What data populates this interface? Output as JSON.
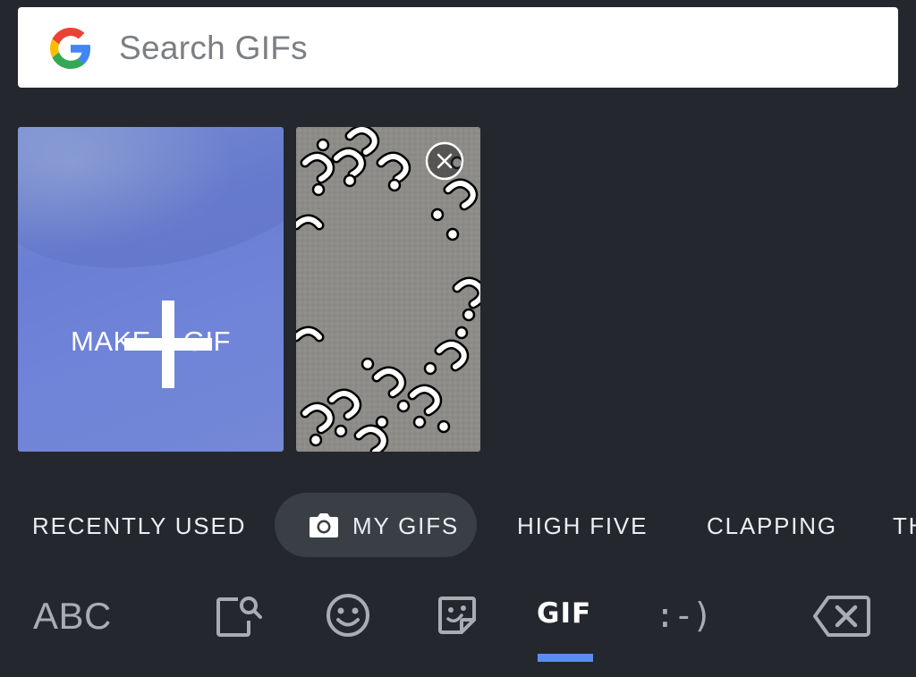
{
  "search": {
    "placeholder": "Search GIFs",
    "icon": "google-g-icon"
  },
  "tiles": {
    "make_gif": {
      "label": "MAKE A GIF",
      "icon": "plus-icon"
    },
    "saved_gif": {
      "remove_icon": "close-icon"
    }
  },
  "categories": [
    {
      "label": "RECENTLY USED",
      "active": false
    },
    {
      "label": "MY GIFS",
      "active": true,
      "icon": "camera-icon"
    },
    {
      "label": "HIGH FIVE",
      "active": false
    },
    {
      "label": "CLAPPING",
      "active": false
    },
    {
      "label": "TH",
      "active": false
    }
  ],
  "toolbar": {
    "abc_label": "ABC",
    "sticker_search_icon": "sticker-search-icon",
    "emoji_icon": "smiley-icon",
    "sticker_icon": "sticker-icon",
    "gif_label": "GIF",
    "emoticon_label": ":-)",
    "backspace_icon": "backspace-icon"
  },
  "colors": {
    "background": "#24282e",
    "active_pill": "#3a3f46",
    "active_underline": "#5b8def",
    "search_bg": "#ffffff",
    "placeholder": "#7b7f83",
    "inactive_icon": "#a9adb2"
  }
}
